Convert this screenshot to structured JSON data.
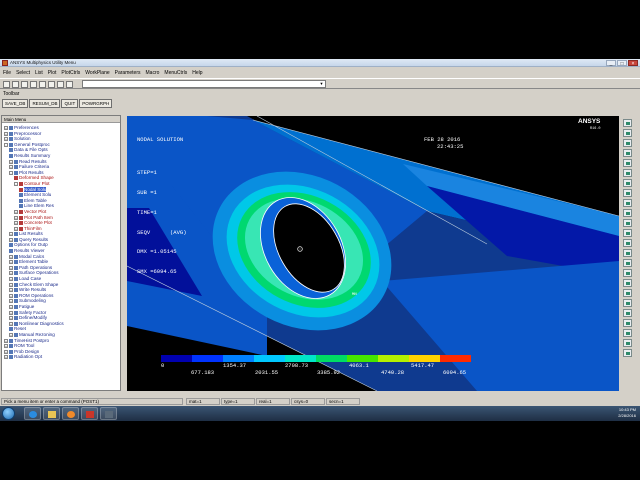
{
  "window": {
    "title": "ANSYS Multiphysics Utility Menu"
  },
  "window_controls": [
    "_",
    "□",
    "×"
  ],
  "menubar": [
    "File",
    "Select",
    "List",
    "Plot",
    "PlotCtrls",
    "WorkPlane",
    "Parameters",
    "Macro",
    "MenuCtrls",
    "Help"
  ],
  "command": {
    "value": ""
  },
  "toolbar": {
    "label": "Toolbar",
    "buttons": [
      "SAVE_DB",
      "RESUM_DB",
      "QUIT",
      "POWRGRPH"
    ]
  },
  "main_menu": {
    "title": "Main Menu",
    "items": [
      {
        "label": "Preferences",
        "level": 0,
        "sign": "+",
        "color": "blue"
      },
      {
        "label": "Preprocessor",
        "level": 0,
        "sign": "+",
        "color": "blue"
      },
      {
        "label": "Solution",
        "level": 0,
        "sign": "+",
        "color": "blue"
      },
      {
        "label": "General Postproc",
        "level": 0,
        "sign": "-",
        "color": "blue"
      },
      {
        "label": "Data & File Opts",
        "level": 1,
        "sign": "",
        "color": "blue"
      },
      {
        "label": "Results Summary",
        "level": 1,
        "sign": "",
        "color": "blue"
      },
      {
        "label": "Read Results",
        "level": 1,
        "sign": "+",
        "color": "blue"
      },
      {
        "label": "Failure Criteria",
        "level": 1,
        "sign": "+",
        "color": "blue"
      },
      {
        "label": "Plot Results",
        "level": 1,
        "sign": "-",
        "color": "blue"
      },
      {
        "label": "Deformed Shape",
        "level": 2,
        "sign": "",
        "color": "red"
      },
      {
        "label": "Contour Plot",
        "level": 2,
        "sign": "-",
        "color": "red"
      },
      {
        "label": "Nodal Solu",
        "level": 3,
        "sign": "",
        "color": "red",
        "selected": true
      },
      {
        "label": "Element Solu",
        "level": 3,
        "sign": "",
        "color": "blue"
      },
      {
        "label": "Elem Table",
        "level": 3,
        "sign": "",
        "color": "blue"
      },
      {
        "label": "Line Elem Res",
        "level": 3,
        "sign": "",
        "color": "blue"
      },
      {
        "label": "Vector Plot",
        "level": 2,
        "sign": "+",
        "color": "red"
      },
      {
        "label": "Plot Path Item",
        "level": 2,
        "sign": "+",
        "color": "red"
      },
      {
        "label": "Concrete Plot",
        "level": 2,
        "sign": "+",
        "color": "red"
      },
      {
        "label": "ThinFilm",
        "level": 2,
        "sign": "+",
        "color": "red"
      },
      {
        "label": "List Results",
        "level": 1,
        "sign": "+",
        "color": "blue"
      },
      {
        "label": "Query Results",
        "level": 1,
        "sign": "+",
        "color": "blue"
      },
      {
        "label": "Options for Outp",
        "level": 1,
        "sign": "",
        "color": "blue"
      },
      {
        "label": "Results Viewer",
        "level": 1,
        "sign": "",
        "color": "blue"
      },
      {
        "label": "Modal Calcs",
        "level": 1,
        "sign": "+",
        "color": "blue"
      },
      {
        "label": "Element Table",
        "level": 1,
        "sign": "+",
        "color": "blue"
      },
      {
        "label": "Path Operations",
        "level": 1,
        "sign": "+",
        "color": "blue"
      },
      {
        "label": "Surface Operations",
        "level": 1,
        "sign": "+",
        "color": "blue"
      },
      {
        "label": "Load Case",
        "level": 1,
        "sign": "+",
        "color": "blue"
      },
      {
        "label": "Check Elem Shape",
        "level": 1,
        "sign": "+",
        "color": "blue"
      },
      {
        "label": "Write Results",
        "level": 1,
        "sign": "+",
        "color": "blue"
      },
      {
        "label": "ROM Operations",
        "level": 1,
        "sign": "+",
        "color": "blue"
      },
      {
        "label": "Submodeling",
        "level": 1,
        "sign": "+",
        "color": "blue"
      },
      {
        "label": "Fatigue",
        "level": 1,
        "sign": "+",
        "color": "blue"
      },
      {
        "label": "Safety Factor",
        "level": 1,
        "sign": "+",
        "color": "blue"
      },
      {
        "label": "Define/Modify",
        "level": 1,
        "sign": "+",
        "color": "blue"
      },
      {
        "label": "Nonlinear Diagnostics",
        "level": 1,
        "sign": "+",
        "color": "blue"
      },
      {
        "label": "Reset",
        "level": 1,
        "sign": "",
        "color": "blue"
      },
      {
        "label": "Manual Rezoning",
        "level": 1,
        "sign": "+",
        "color": "blue"
      },
      {
        "label": "TimeHist Postpro",
        "level": 0,
        "sign": "+",
        "color": "blue"
      },
      {
        "label": "ROM Tool",
        "level": 0,
        "sign": "+",
        "color": "blue"
      },
      {
        "label": "Prob Design",
        "level": 0,
        "sign": "+",
        "color": "blue"
      },
      {
        "label": "Radiation Opt",
        "level": 0,
        "sign": "+",
        "color": "blue"
      }
    ]
  },
  "graphics": {
    "info_lines": [
      "NODAL SOLUTION",
      "",
      "STEP=1",
      "SUB =1",
      "TIME=1",
      "SEQV      (AVG)",
      "DMX =1.05145",
      "SMX =6094.65"
    ],
    "logo": "ANSYS",
    "logo_sub": "R16.0",
    "date": "FEB 28 2016",
    "time": "22:43:25",
    "mn_label": "MN",
    "mx_label": "MX",
    "legend_top": [
      "0",
      "1354.37",
      "2708.73",
      "4063.1",
      "5417.47"
    ],
    "legend_bottom": [
      "677.183",
      "2031.55",
      "3385.92",
      "4740.28",
      "6094.65"
    ],
    "legend_colors": [
      "#0000b0",
      "#0033ff",
      "#0080ff",
      "#00c8ff",
      "#00e6c8",
      "#00dc64",
      "#46e600",
      "#b4f000",
      "#ffd200",
      "#ff2a00"
    ]
  },
  "status_bar": {
    "prompt": "Pick a menu item or enter a command (POST1)",
    "mat": "mat=1",
    "type": "type=1",
    "real": "real=1",
    "csys": "csys=0",
    "secn": "secn=1"
  },
  "taskbar": {
    "time": "10:43 PM",
    "date": "2/28/2016"
  }
}
